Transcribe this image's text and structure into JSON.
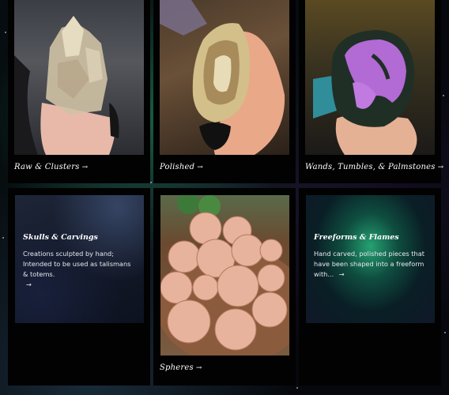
{
  "cards": [
    {
      "title": "Raw & Clusters",
      "arrow": "→",
      "image_alt": "clear quartz cluster held in hand"
    },
    {
      "title": "Polished",
      "arrow": "→",
      "image_alt": "polished agate slice held in hand"
    },
    {
      "title": "Wands, Tumbles, & Palmstones",
      "arrow": "→",
      "image_alt": "purple and green palm stone held in hand"
    },
    {
      "title": "Skulls & Carvings",
      "description": "Creations sculpted by hand; Intended to be used as talismans & totems.",
      "arrow": "→"
    },
    {
      "title": "Spheres",
      "arrow": "→",
      "image_alt": "pink stone spheres in a wooden bowl"
    },
    {
      "title": "Freeforms & Flames",
      "description": "Hand carved, polished pieces that have been shaped into a freeform with...",
      "arrow": "→"
    }
  ],
  "colors": {
    "card_bg": "#020203",
    "aurora_green": "#28aa78",
    "text": "#ffffff"
  }
}
